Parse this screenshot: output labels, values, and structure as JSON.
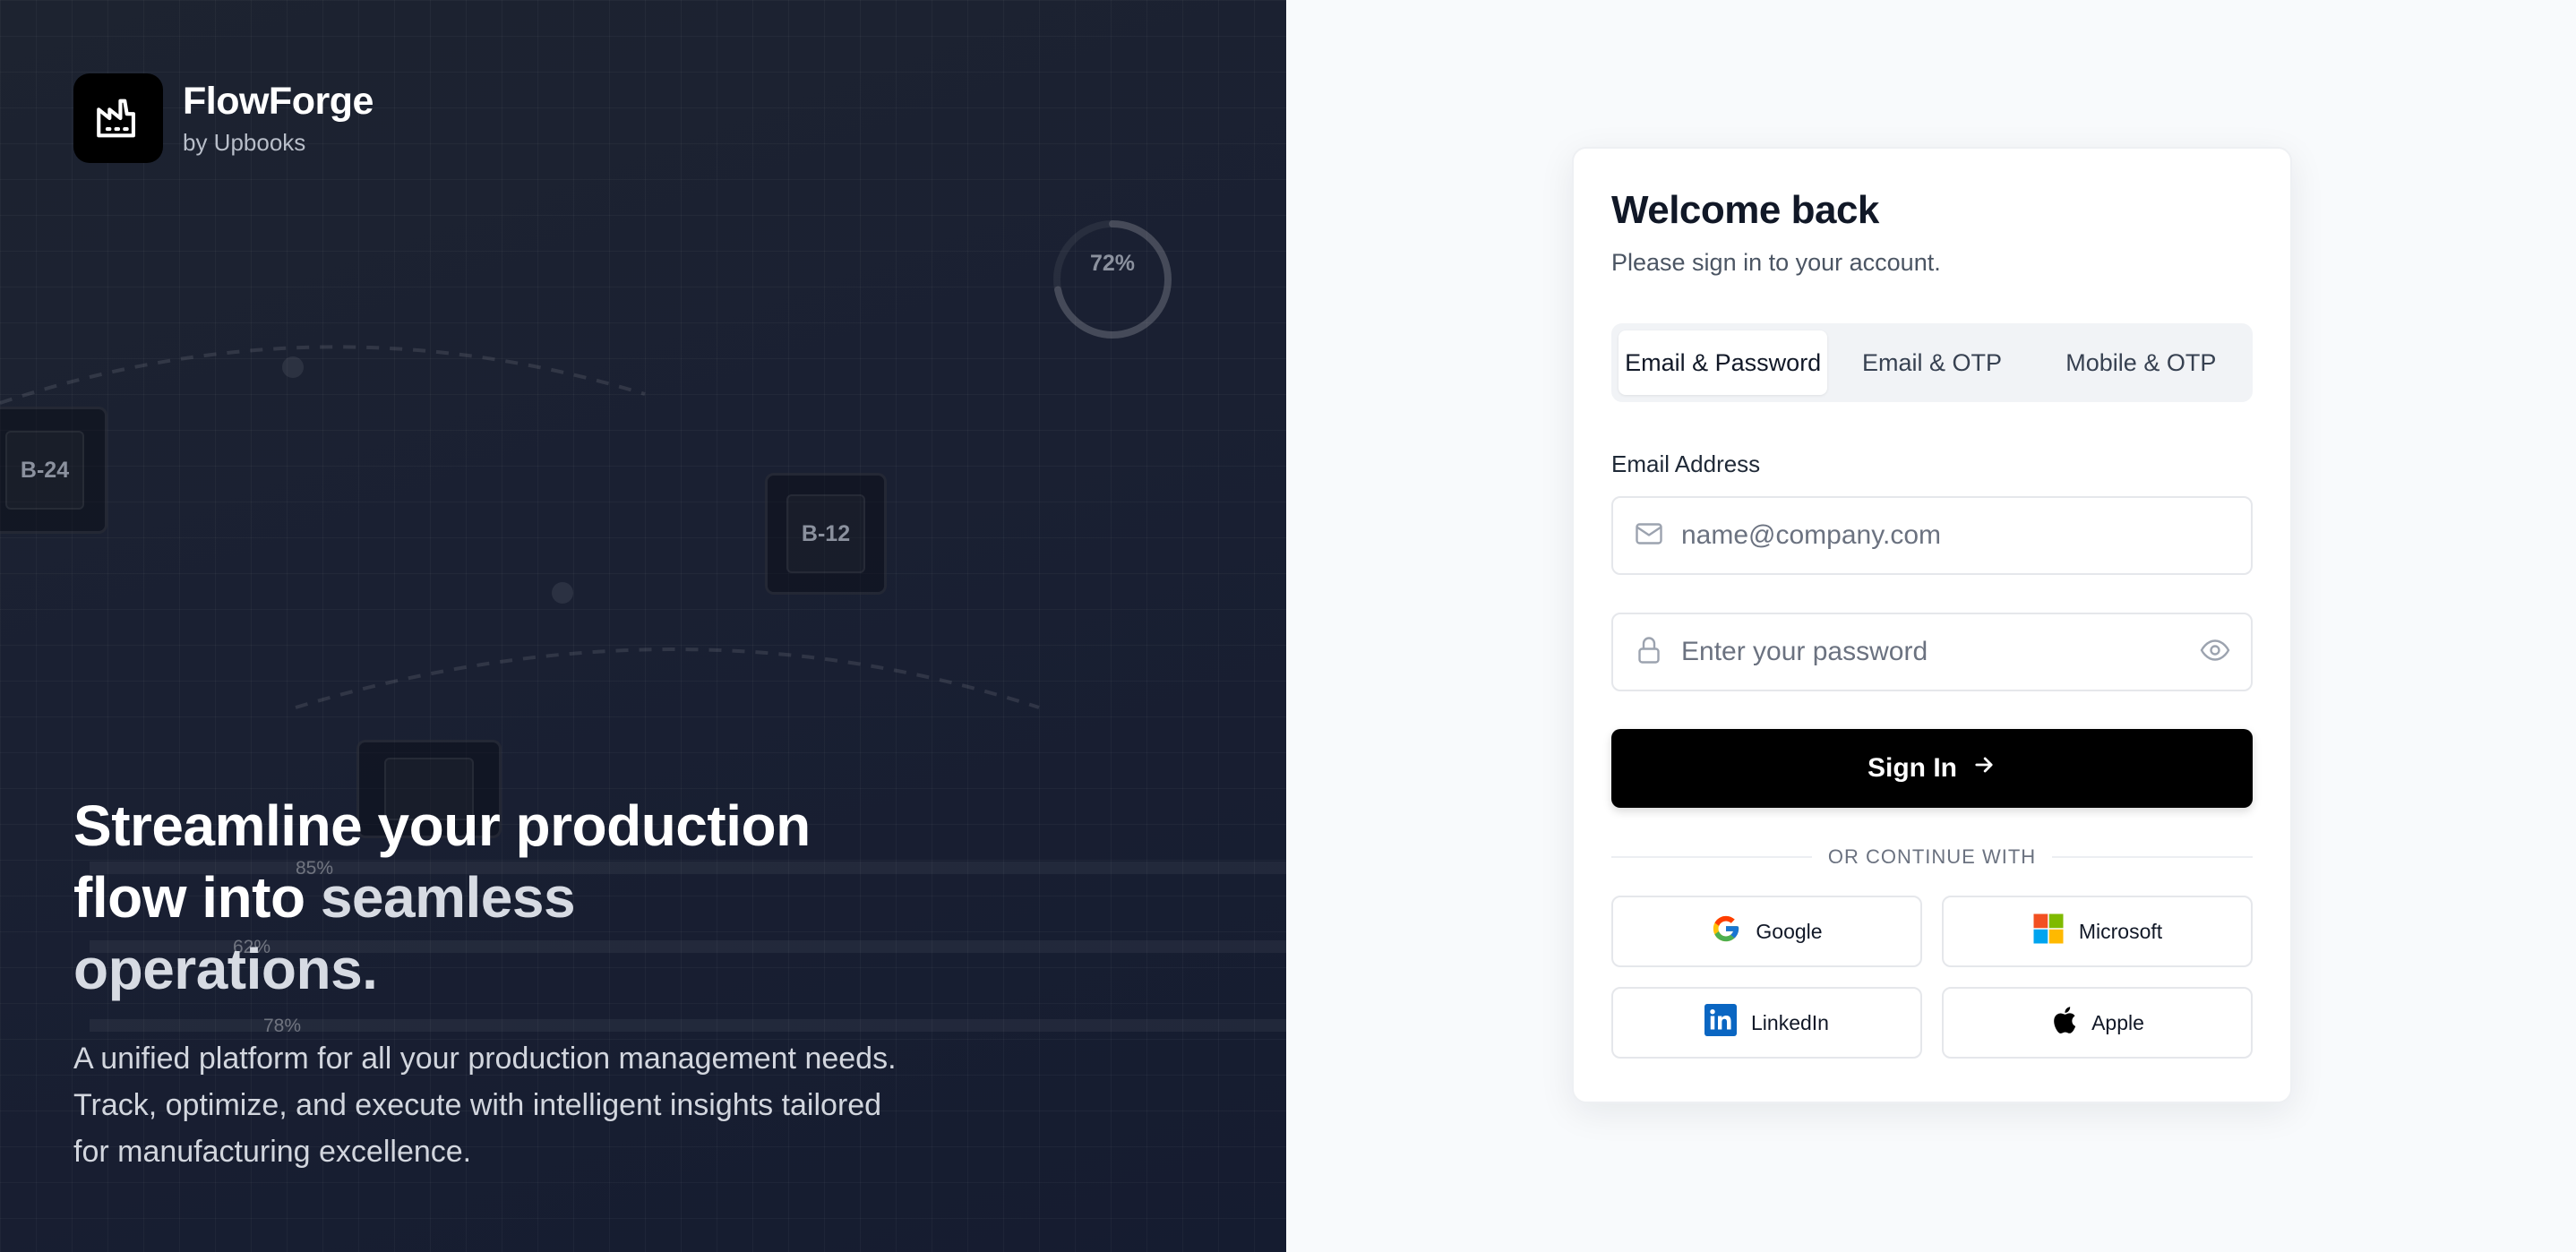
{
  "brand": {
    "name": "FlowForge",
    "subtitle": "by Upbooks"
  },
  "hero": {
    "headline_line1": "Streamline your production",
    "headline_line2_a": "flow into ",
    "headline_line2_b": "seamless",
    "headline_line3": "operations.",
    "description": "A unified platform for all your production management needs. Track, optimize, and execute with intelligent insights tailored for manufacturing excellence.",
    "batches": [
      "B-24",
      "B-12"
    ],
    "progress_ring": "72%",
    "progress_ring_value": 0.72,
    "bar_labels": [
      "85%",
      "62%",
      "78%"
    ]
  },
  "auth": {
    "title": "Welcome back",
    "subtitle": "Please sign in to your account.",
    "tabs": [
      {
        "label": "Email & Password",
        "active": true
      },
      {
        "label": "Email & OTP",
        "active": false
      },
      {
        "label": "Mobile & OTP",
        "active": false
      }
    ],
    "email_label": "Email Address",
    "email_placeholder": "name@company.com",
    "password_placeholder": "Enter your password",
    "signin_label": "Sign In",
    "divider_text": "OR CONTINUE WITH",
    "social": {
      "google": "Google",
      "microsoft": "Microsoft",
      "linkedin": "LinkedIn",
      "apple": "Apple"
    }
  },
  "colors": {
    "hero_bg": "#1a2032",
    "primary_button": "#000000",
    "card_bg": "#ffffff",
    "page_bg": "#f8fafc"
  }
}
